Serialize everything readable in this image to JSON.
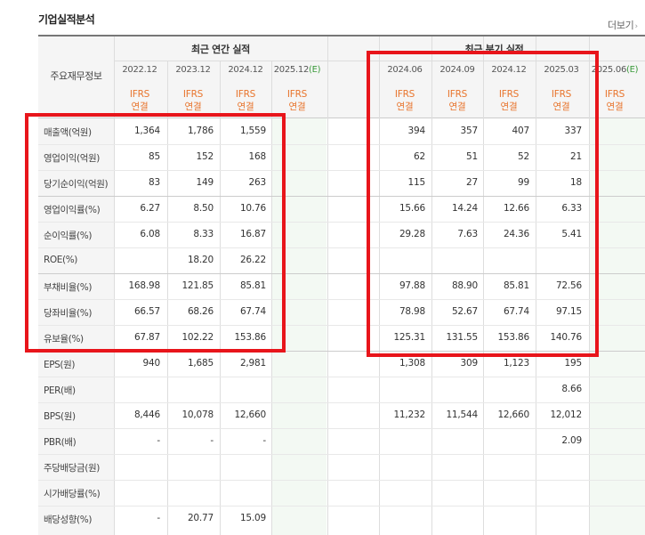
{
  "title": "기업실적분석",
  "more": {
    "label": "더보기",
    "chev": "›"
  },
  "header": {
    "main_label": "주요재무정보",
    "annual_title": "최근 연간 실적",
    "quarter_title": "최근 분기 실적",
    "ifrs_top": "IFRS",
    "ifrs_bottom": "연결"
  },
  "annual_periods": [
    {
      "label": "2022.12",
      "estimate": ""
    },
    {
      "label": "2023.12",
      "estimate": ""
    },
    {
      "label": "2024.12",
      "estimate": ""
    },
    {
      "label": "2025.12",
      "estimate": "(E)"
    }
  ],
  "quarter_periods": [
    {
      "label": "2024.06",
      "estimate": ""
    },
    {
      "label": "2024.09",
      "estimate": ""
    },
    {
      "label": "2024.12",
      "estimate": ""
    },
    {
      "label": "2025.03",
      "estimate": ""
    },
    {
      "label": "2025.06",
      "estimate": "(E)"
    }
  ],
  "rows": [
    {
      "label": "매출액(억원)",
      "annual": [
        "1,364",
        "1,786",
        "1,559",
        ""
      ],
      "quarter": [
        "394",
        "357",
        "407",
        "337",
        ""
      ]
    },
    {
      "label": "영업이익(억원)",
      "annual": [
        "85",
        "152",
        "168",
        ""
      ],
      "quarter": [
        "62",
        "51",
        "52",
        "21",
        ""
      ]
    },
    {
      "label": "당기순이익(억원)",
      "annual": [
        "83",
        "149",
        "263",
        ""
      ],
      "quarter": [
        "115",
        "27",
        "99",
        "18",
        ""
      ]
    },
    {
      "label": "영업이익률(%)",
      "annual": [
        "6.27",
        "8.50",
        "10.76",
        ""
      ],
      "quarter": [
        "15.66",
        "14.24",
        "12.66",
        "6.33",
        ""
      ]
    },
    {
      "label": "순이익률(%)",
      "annual": [
        "6.08",
        "8.33",
        "16.87",
        ""
      ],
      "quarter": [
        "29.28",
        "7.63",
        "24.36",
        "5.41",
        ""
      ]
    },
    {
      "label": "ROE(%)",
      "annual": [
        "",
        "18.20",
        "26.22",
        ""
      ],
      "quarter": [
        "",
        "",
        "",
        "",
        ""
      ]
    },
    {
      "label": "부채비율(%)",
      "annual": [
        "168.98",
        "121.85",
        "85.81",
        ""
      ],
      "quarter": [
        "97.88",
        "88.90",
        "85.81",
        "72.56",
        ""
      ]
    },
    {
      "label": "당좌비율(%)",
      "annual": [
        "66.57",
        "68.26",
        "67.74",
        ""
      ],
      "quarter": [
        "78.98",
        "52.67",
        "67.74",
        "97.15",
        ""
      ]
    },
    {
      "label": "유보율(%)",
      "annual": [
        "67.87",
        "102.22",
        "153.86",
        ""
      ],
      "quarter": [
        "125.31",
        "131.55",
        "153.86",
        "140.76",
        ""
      ]
    },
    {
      "label": "EPS(원)",
      "annual": [
        "940",
        "1,685",
        "2,981",
        ""
      ],
      "quarter": [
        "1,308",
        "309",
        "1,123",
        "195",
        ""
      ]
    },
    {
      "label": "PER(배)",
      "annual": [
        "",
        "",
        "",
        ""
      ],
      "quarter": [
        "",
        "",
        "",
        "8.66",
        ""
      ]
    },
    {
      "label": "BPS(원)",
      "annual": [
        "8,446",
        "10,078",
        "12,660",
        ""
      ],
      "quarter": [
        "11,232",
        "11,544",
        "12,660",
        "12,012",
        ""
      ]
    },
    {
      "label": "PBR(배)",
      "annual": [
        "-",
        "-",
        "-",
        ""
      ],
      "quarter": [
        "",
        "",
        "",
        "2.09",
        ""
      ]
    },
    {
      "label": "주당배당금(원)",
      "annual": [
        "",
        "",
        "",
        ""
      ],
      "quarter": [
        "",
        "",
        "",
        "",
        ""
      ]
    },
    {
      "label": "시가배당률(%)",
      "annual": [
        "",
        "",
        "",
        ""
      ],
      "quarter": [
        "",
        "",
        "",
        "",
        ""
      ]
    },
    {
      "label": "배당성향(%)",
      "annual": [
        "-",
        "20.77",
        "15.09",
        ""
      ],
      "quarter": [
        "",
        "",
        "",
        "",
        ""
      ]
    }
  ],
  "colors": {
    "highlight_box": "#e8151b",
    "ifrs_text": "#e8742c",
    "estimate_text": "#3a9a3a",
    "estimate_column_bg": "#f3f9f3",
    "header_bg": "#f5f5f5"
  }
}
